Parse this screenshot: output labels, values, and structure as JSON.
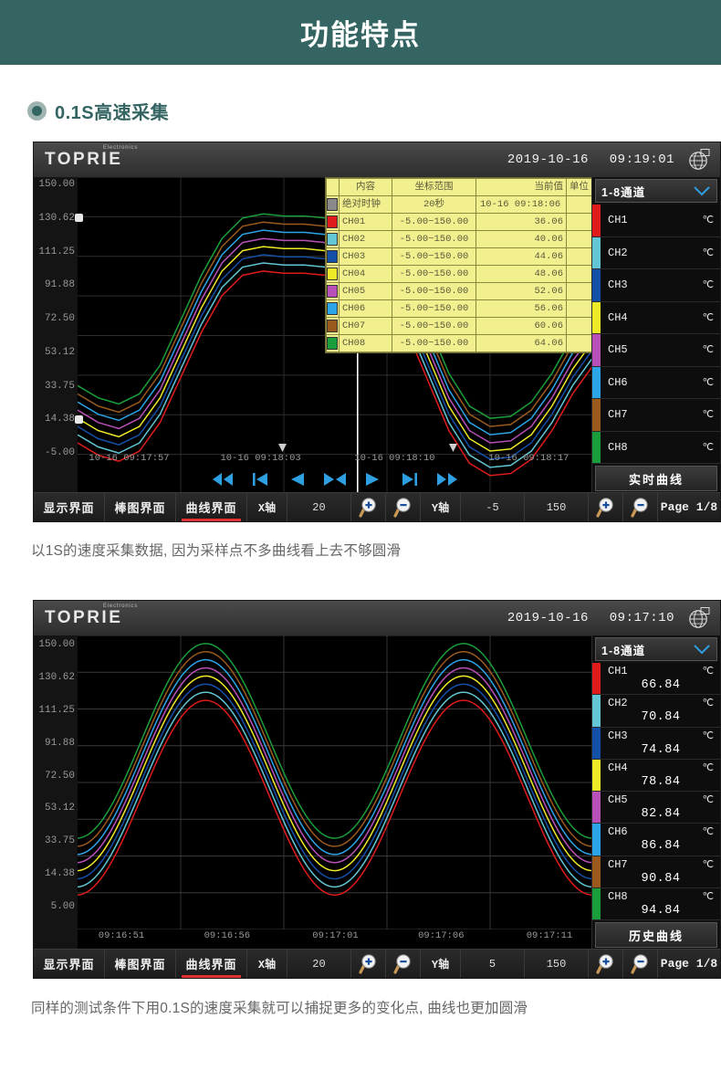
{
  "page": {
    "header_title": "功能特点",
    "section_label": "0.1S高速采集",
    "caption_1": "以1S的速度采集数据, 因为采样点不多曲线看上去不够圆滑",
    "caption_2": "同样的测试条件下用0.1S的速度采集就可以捕捉更多的变化点, 曲线也更加圆滑",
    "accent_color": "#356562"
  },
  "channel_colors": [
    "#e01b1b",
    "#63c6d4",
    "#1450a8",
    "#eeea28",
    "#b850b8",
    "#2ba4e8",
    "#9a5a1e",
    "#1a9e3c"
  ],
  "device1": {
    "topbar": {
      "brand": "TOPRIE",
      "brand_sup": "Electronics",
      "date": "2019-10-16",
      "time": "09:19:01",
      "globe_icon": "globe-icon"
    },
    "yaxis": {
      "ticks": [
        "150.00",
        "130.62",
        "111.25",
        "91.88",
        "72.50",
        "53.12",
        "33.75",
        "14.38",
        "-5.00"
      ]
    },
    "xaxis": {
      "ticks": [
        "10-16 09:17:57",
        "10-16 09:18:03",
        "10-16 09:18:10",
        "10-16 09:18:17"
      ]
    },
    "table": {
      "headers": [
        "内容",
        "坐标范围",
        "当前值",
        "单位"
      ],
      "rows": [
        {
          "swatch": "#8a8a8a",
          "name": "绝对时钟",
          "range": "20秒",
          "value": "10-16 09:18:06",
          "unit": ""
        },
        {
          "swatch": "#e01b1b",
          "name": "CH01",
          "range": "-5.00~150.00",
          "value": "36.06",
          "unit": ""
        },
        {
          "swatch": "#63c6d4",
          "name": "CH02",
          "range": "-5.00~150.00",
          "value": "40.06",
          "unit": ""
        },
        {
          "swatch": "#1450a8",
          "name": "CH03",
          "range": "-5.00~150.00",
          "value": "44.06",
          "unit": ""
        },
        {
          "swatch": "#eeea28",
          "name": "CH04",
          "range": "-5.00~150.00",
          "value": "48.06",
          "unit": ""
        },
        {
          "swatch": "#b850b8",
          "name": "CH05",
          "range": "-5.00~150.00",
          "value": "52.06",
          "unit": ""
        },
        {
          "swatch": "#2ba4e8",
          "name": "CH06",
          "range": "-5.00~150.00",
          "value": "56.06",
          "unit": ""
        },
        {
          "swatch": "#9a5a1e",
          "name": "CH07",
          "range": "-5.00~150.00",
          "value": "60.06",
          "unit": ""
        },
        {
          "swatch": "#1a9e3c",
          "name": "CH08",
          "range": "-5.00~150.00",
          "value": "64.06",
          "unit": ""
        }
      ]
    },
    "sidebar": {
      "select_label": "1-8通道",
      "channels": [
        {
          "name": "CH1",
          "unit": "℃",
          "value": ""
        },
        {
          "name": "CH2",
          "unit": "℃",
          "value": ""
        },
        {
          "name": "CH3",
          "unit": "℃",
          "value": ""
        },
        {
          "name": "CH4",
          "unit": "℃",
          "value": ""
        },
        {
          "name": "CH5",
          "unit": "℃",
          "value": ""
        },
        {
          "name": "CH6",
          "unit": "℃",
          "value": ""
        },
        {
          "name": "CH7",
          "unit": "℃",
          "value": ""
        },
        {
          "name": "CH8",
          "unit": "℃",
          "value": ""
        }
      ],
      "button_label": "实时曲线"
    },
    "nav_buttons": [
      "rewind-fast-icon",
      "skip-start-icon",
      "step-back-icon",
      "center-icon",
      "play-icon",
      "skip-end-icon",
      "forward-fast-icon"
    ],
    "toolbar": {
      "tabs": [
        {
          "label": "显示界面",
          "active": false
        },
        {
          "label": "棒图界面",
          "active": false
        },
        {
          "label": "曲线界面",
          "active": true
        }
      ],
      "x_label": "X轴",
      "x_value": "20",
      "y_label": "Y轴",
      "y_min": "-5",
      "y_max": "150",
      "page": "Page 1/8"
    },
    "chart_data": {
      "type": "line",
      "title": "",
      "xlabel": "",
      "ylabel": "",
      "ylim": [
        -5,
        150
      ],
      "grid": true,
      "x_tick_labels": [
        "10-16 09:17:57",
        "10-16 09:18:03",
        "10-16 09:18:10",
        "10-16 09:18:17"
      ],
      "y_tick_labels": [
        "150.00",
        "130.62",
        "111.25",
        "91.88",
        "72.50",
        "53.12",
        "33.75",
        "14.38",
        "-5.00"
      ],
      "sampling_rate": "1S",
      "legend": [
        "CH01",
        "CH02",
        "CH03",
        "CH04",
        "CH05",
        "CH06",
        "CH07",
        "CH08"
      ],
      "x": [
        0,
        0.04,
        0.08,
        0.12,
        0.16,
        0.2,
        0.24,
        0.28,
        0.32,
        0.36,
        0.4,
        0.44,
        0.48,
        0.52,
        0.56,
        0.6,
        0.64,
        0.68,
        0.72,
        0.76,
        0.8,
        0.84,
        0.88,
        0.92,
        0.96,
        1.0
      ],
      "series": [
        {
          "name": "CH01",
          "color": "#e01b1b",
          "values": [
            20,
            14,
            11,
            16,
            30,
            52,
            74,
            92,
            102,
            104,
            103,
            103,
            102,
            103,
            102,
            96,
            74,
            50,
            26,
            10,
            4,
            5,
            12,
            26,
            44,
            58
          ]
        },
        {
          "name": "CH02",
          "color": "#63c6d4",
          "values": [
            24,
            18,
            15,
            20,
            34,
            56,
            78,
            96,
            106,
            108,
            107,
            107,
            106,
            107,
            106,
            100,
            78,
            54,
            30,
            14,
            8,
            9,
            16,
            30,
            48,
            62
          ]
        },
        {
          "name": "CH03",
          "color": "#1450a8",
          "values": [
            28,
            22,
            19,
            24,
            38,
            60,
            82,
            100,
            110,
            112,
            111,
            111,
            110,
            111,
            110,
            104,
            82,
            58,
            34,
            18,
            12,
            13,
            20,
            34,
            52,
            66
          ]
        },
        {
          "name": "CH04",
          "color": "#eeea28",
          "values": [
            32,
            26,
            23,
            28,
            42,
            64,
            86,
            104,
            114,
            116,
            115,
            115,
            114,
            115,
            114,
            108,
            86,
            62,
            38,
            22,
            16,
            17,
            24,
            38,
            56,
            70
          ]
        },
        {
          "name": "CH05",
          "color": "#b850b8",
          "values": [
            36,
            30,
            27,
            32,
            46,
            68,
            90,
            108,
            118,
            120,
            119,
            119,
            118,
            119,
            118,
            112,
            90,
            66,
            42,
            26,
            20,
            21,
            28,
            42,
            60,
            74
          ]
        },
        {
          "name": "CH06",
          "color": "#2ba4e8",
          "values": [
            40,
            34,
            31,
            36,
            50,
            72,
            94,
            112,
            122,
            124,
            123,
            123,
            122,
            123,
            122,
            116,
            94,
            70,
            46,
            30,
            24,
            25,
            32,
            46,
            64,
            78
          ]
        },
        {
          "name": "CH07",
          "color": "#9a5a1e",
          "values": [
            44,
            38,
            35,
            40,
            54,
            76,
            98,
            116,
            126,
            128,
            127,
            127,
            126,
            127,
            126,
            120,
            98,
            74,
            50,
            34,
            28,
            29,
            36,
            50,
            68,
            82
          ]
        },
        {
          "name": "CH08",
          "color": "#1a9e3c",
          "values": [
            48,
            42,
            39,
            44,
            58,
            80,
            102,
            120,
            130,
            132,
            131,
            131,
            130,
            131,
            130,
            124,
            102,
            78,
            54,
            38,
            32,
            33,
            40,
            54,
            72,
            86
          ]
        }
      ]
    }
  },
  "device2": {
    "topbar": {
      "brand": "TOPRIE",
      "brand_sup": "Electronics",
      "date": "2019-10-16",
      "time": "09:17:10",
      "globe_icon": "globe-icon"
    },
    "yaxis": {
      "ticks": [
        "150.00",
        "130.62",
        "111.25",
        "91.88",
        "72.50",
        "53.12",
        "33.75",
        "14.38",
        "5.00"
      ]
    },
    "xaxis": {
      "ticks": [
        "09:16:51",
        "09:16:56",
        "09:17:01",
        "09:17:06",
        "09:17:11"
      ]
    },
    "sidebar": {
      "select_label": "1-8通道",
      "channels": [
        {
          "name": "CH1",
          "unit": "℃",
          "value": "66.84"
        },
        {
          "name": "CH2",
          "unit": "℃",
          "value": "70.84"
        },
        {
          "name": "CH3",
          "unit": "℃",
          "value": "74.84"
        },
        {
          "name": "CH4",
          "unit": "℃",
          "value": "78.84"
        },
        {
          "name": "CH5",
          "unit": "℃",
          "value": "82.84"
        },
        {
          "name": "CH6",
          "unit": "℃",
          "value": "86.84"
        },
        {
          "name": "CH7",
          "unit": "℃",
          "value": "90.84"
        },
        {
          "name": "CH8",
          "unit": "℃",
          "value": "94.84"
        }
      ],
      "button_label": "历史曲线"
    },
    "toolbar": {
      "tabs": [
        {
          "label": "显示界面",
          "active": false
        },
        {
          "label": "棒图界面",
          "active": false
        },
        {
          "label": "曲线界面",
          "active": true
        }
      ],
      "x_label": "X轴",
      "x_value": "20",
      "y_label": "Y轴",
      "y_min": "5",
      "y_max": "150",
      "page": "Page 1/8"
    },
    "chart_data": {
      "type": "line",
      "title": "",
      "xlabel": "",
      "ylabel": "",
      "ylim": [
        5,
        150
      ],
      "grid": true,
      "x_tick_labels": [
        "09:16:51",
        "09:16:56",
        "09:17:01",
        "09:17:06",
        "09:17:11"
      ],
      "y_tick_labels": [
        "150.00",
        "130.62",
        "111.25",
        "91.88",
        "72.50",
        "53.12",
        "33.75",
        "14.38",
        "5.00"
      ],
      "sampling_rate": "0.1S",
      "legend": [
        "CH1",
        "CH2",
        "CH3",
        "CH4",
        "CH5",
        "CH6",
        "CH7",
        "CH8"
      ],
      "waveform": "sine",
      "cycles": 2,
      "amplitude": 48,
      "offset": 70,
      "channel_step": 4
    }
  }
}
